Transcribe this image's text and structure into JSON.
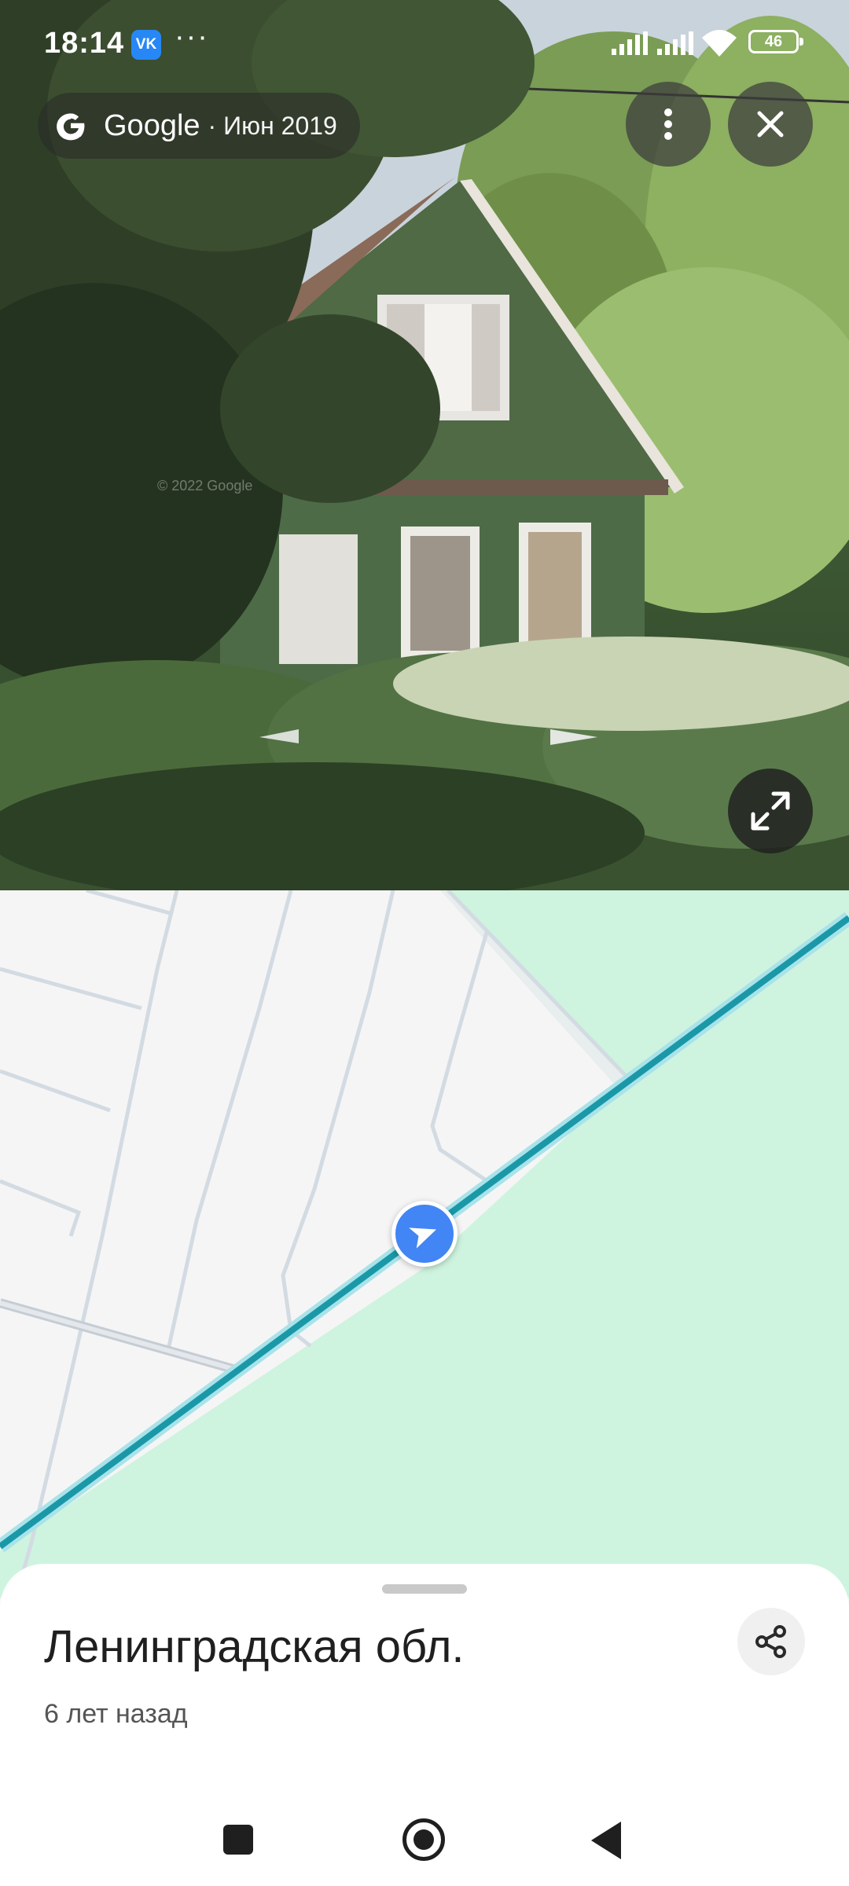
{
  "status_bar": {
    "time": "18:14",
    "app_badge": "VK",
    "overflow": "···",
    "battery": "46"
  },
  "street_view": {
    "attribution_brand": "Google",
    "capture_date": "· Июн 2019",
    "copyright": "© 2022 Google",
    "icons": {
      "more": "more-vert-icon",
      "close": "close-icon",
      "expand": "expand-icon"
    }
  },
  "map": {
    "marker_icon": "navigation-arrow-icon",
    "colors": {
      "park": "#cef4df",
      "road": "#1a98a8",
      "marker": "#4285f4"
    }
  },
  "place": {
    "title": "Ленинградская обл.",
    "subtitle": "6 лет назад",
    "share_icon": "share-icon"
  },
  "nav_bar": {
    "recent": "recents-icon",
    "home": "home-icon",
    "back": "back-icon"
  }
}
